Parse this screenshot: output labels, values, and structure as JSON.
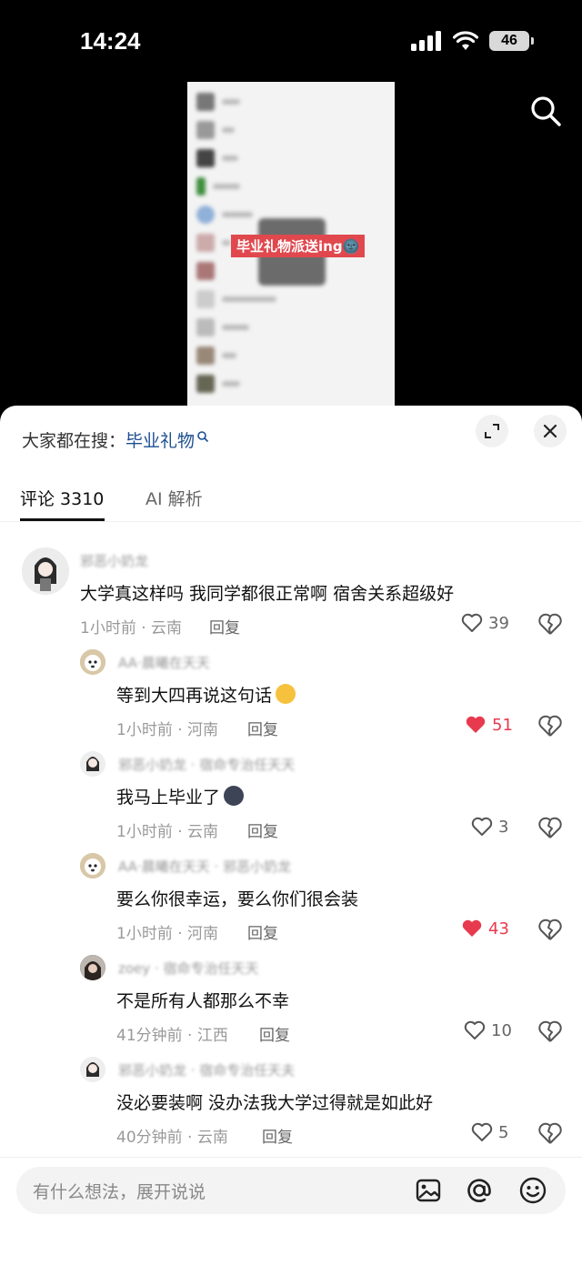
{
  "status_bar": {
    "time": "14:24",
    "battery": "46"
  },
  "video": {
    "banner_text": "毕业礼物派送ing🌚"
  },
  "search_bar": {
    "prefix": "大家都在搜：",
    "keyword": "毕业礼物"
  },
  "tabs": [
    {
      "label": "评论 3310",
      "active": true
    },
    {
      "label": "AI 解析",
      "active": false
    }
  ],
  "comments": [
    {
      "username": "邪恶小奶龙",
      "text": "大学真这样吗 我同学都很正常啊 宿舍关系超级好",
      "time": "1小时前 · 云南",
      "reply": "回复",
      "likes": "39",
      "liked": false
    },
    {
      "username": "AA·晨曦在天天",
      "text": "等到大四再说这句话",
      "time": "1小时前 · 河南",
      "reply": "回复",
      "likes": "51",
      "liked": true
    },
    {
      "username": "邪恶小奶龙 · 宿命专治任天天",
      "text": "我马上毕业了",
      "time": "1小时前 · 云南",
      "reply": "回复",
      "likes": "3",
      "liked": false
    },
    {
      "username": "AA·晨曦在天天 · 邪恶小奶龙",
      "text": "要么你很幸运，要么你们很会装",
      "time": "1小时前 · 河南",
      "reply": "回复",
      "likes": "43",
      "liked": true
    },
    {
      "username": "zoey · 宿命专治任天天",
      "text": "不是所有人都那么不幸",
      "time": "41分钟前 · 江西",
      "reply": "回复",
      "likes": "10",
      "liked": false
    },
    {
      "username": "邪恶小奶龙 · 宿命专治任天夫",
      "text": "没必要装啊 没办法我大学过得就是如此好",
      "time": "40分钟前 · 云南",
      "reply": "回复",
      "likes": "5",
      "liked": false
    }
  ],
  "input": {
    "placeholder": "有什么想法，展开说说"
  },
  "colors": {
    "accent_link": "#1d4f91",
    "like_red": "#e83a4f",
    "banner_red": "#e0484e"
  }
}
